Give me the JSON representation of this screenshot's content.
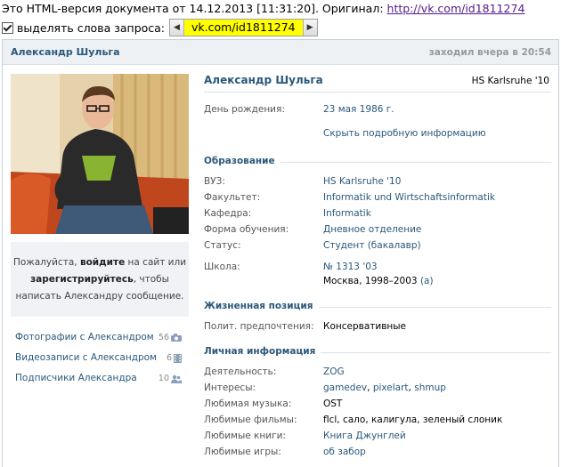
{
  "cache": {
    "notice": "Это HTML-версия документа от 14.12.2013 [11:31:20]. Оригинал: ",
    "original_link": "http://vk.com/id1811274",
    "highlight_label": "выделять слова запроса:",
    "search_term": "vk.com/id1811274"
  },
  "header": {
    "name": "Александр Шульга",
    "status": "заходил вчера в 20:54"
  },
  "login_box": {
    "line1_pre": "Пожалуйста, ",
    "line1_bold": "войдите",
    "line1_post": " на сайт или",
    "line2_bold": "зарегистрируйтесь",
    "line2_post": ", чтобы",
    "line3": "написать Александру сообщение."
  },
  "left_links": [
    {
      "label": "Фотографии с Александром",
      "count": "56",
      "icon": "camera-icon"
    },
    {
      "label": "Видеозаписи с Александром",
      "count": "6",
      "icon": "film-icon"
    },
    {
      "label": "Подписчики Александра",
      "count": "10",
      "icon": "users-icon"
    }
  ],
  "profile": {
    "name": "Александр Шульга",
    "university_short": "HS Karlsruhe '10",
    "birthday_label": "День рождения:",
    "birthday": "23 мая 1986 г.",
    "toggle_details": "Скрыть подробную информацию"
  },
  "education": {
    "title": "Образование",
    "rows": [
      {
        "label": "ВУЗ:",
        "value": "HS Karlsruhe '10"
      },
      {
        "label": "Факультет:",
        "value": "Informatik und Wirtschaftsinformatik"
      },
      {
        "label": "Кафедра:",
        "value": "Informatik"
      },
      {
        "label": "Форма обучения:",
        "value": "Дневное отделение"
      },
      {
        "label": "Статус:",
        "value": "Студент (бакалавр)"
      }
    ],
    "school_label": "Школа:",
    "school_name": "№ 1313 '03",
    "school_city": "Москва, 1998–2003",
    "school_letter": "(а)"
  },
  "life_position": {
    "title": "Жизненная позиция",
    "political_label": "Полит. предпочтения:",
    "political_value": "Консервативные"
  },
  "personal": {
    "title": "Личная информация",
    "activity_label": "Деятельность:",
    "activity": "ZOG",
    "interests_label": "Интересы:",
    "interests": [
      "gamedev",
      "pixelart",
      "shmup"
    ],
    "music_label": "Любимая музыка:",
    "music": "OST",
    "movies_label": "Любимые фильмы:",
    "movies": "flcl, сало, калигула, зеленый слоник",
    "books_label": "Любимые книги:",
    "books": "Книга Джунглей",
    "games_label": "Любимые игры:",
    "games": "об забор"
  },
  "colors": {
    "link_blue": "#2b587a",
    "header_bg": "#eef1f4",
    "highlight": "#ffff00"
  }
}
